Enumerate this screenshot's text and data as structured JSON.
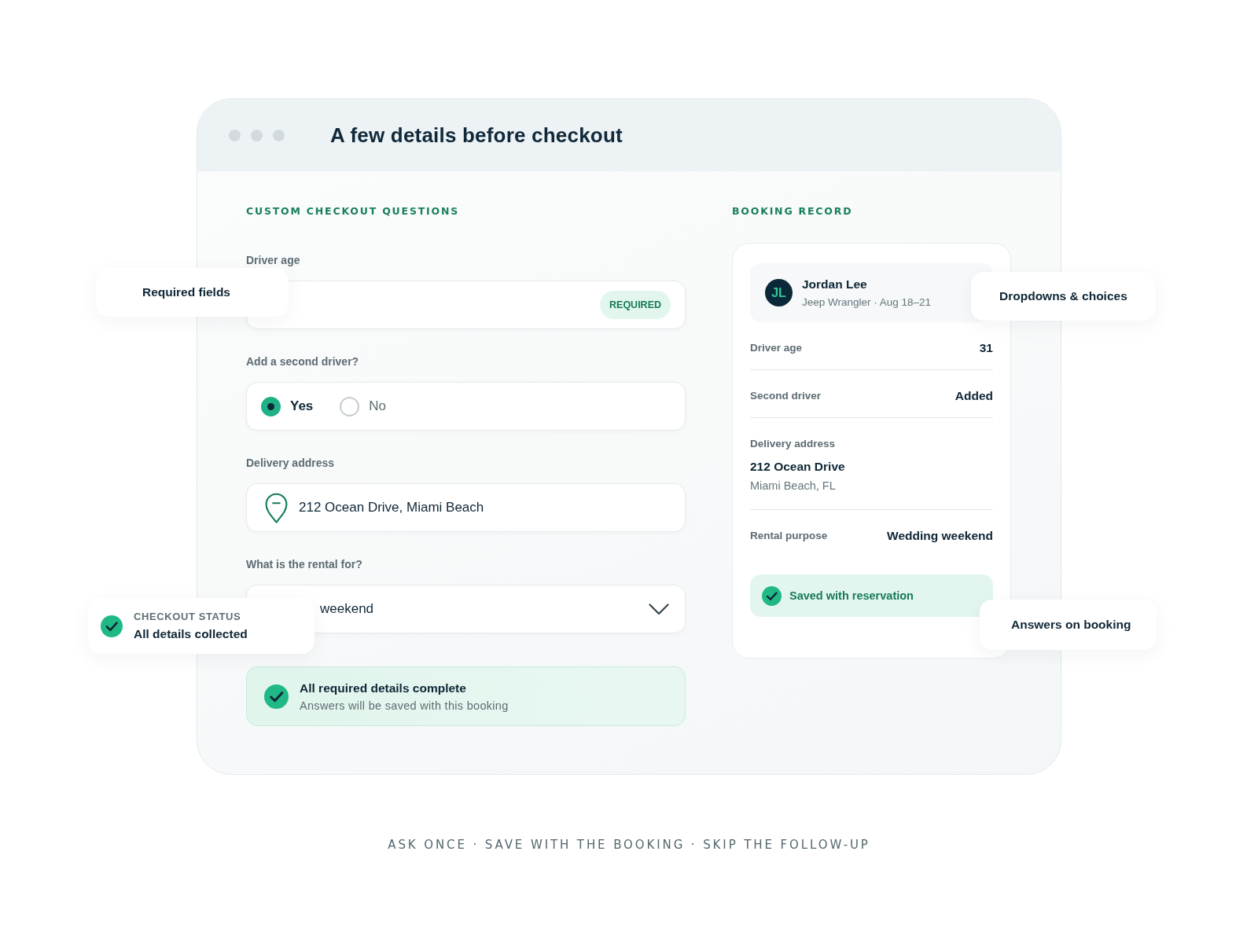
{
  "window": {
    "title": "A few details before checkout"
  },
  "questions": {
    "heading": "CUSTOM CHECKOUT QUESTIONS",
    "fields": [
      {
        "kind": "text",
        "label": "Driver age",
        "badge": "REQUIRED"
      },
      {
        "kind": "radio",
        "label": "Add a second driver?",
        "options": [
          {
            "label": "Yes",
            "selected": true
          },
          {
            "label": "No",
            "selected": false
          }
        ]
      },
      {
        "kind": "address",
        "label": "Delivery address",
        "value": "212 Ocean Drive, Miami Beach"
      },
      {
        "kind": "select",
        "label": "What is the rental for?",
        "value": "weekend"
      }
    ],
    "status_banner": {
      "title": "All required details complete",
      "subtitle": "Answers will be saved with this booking"
    }
  },
  "booking_record": {
    "heading": "BOOKING RECORD",
    "customer": {
      "initials": "JL",
      "name": "Jordan Lee",
      "details": "Jeep Wrangler · Aug 18–21"
    },
    "rows": [
      {
        "kind": "inline",
        "label": "Driver age",
        "value": "31"
      },
      {
        "kind": "inline",
        "label": "Second driver",
        "value": "Added"
      },
      {
        "kind": "stacked",
        "label": "Delivery address",
        "value": "212 Ocean Drive",
        "detail": "Miami Beach, FL"
      },
      {
        "kind": "inline",
        "label": "Rental purpose",
        "value": "Wedding weekend"
      }
    ],
    "saved_note": "Saved with reservation"
  },
  "callouts": [
    {
      "kind": "label",
      "text": "Required fields"
    },
    {
      "kind": "label",
      "text": "Dropdowns & choices"
    },
    {
      "kind": "status",
      "eyebrow": "CHECKOUT STATUS",
      "text": "All details collected"
    },
    {
      "kind": "label",
      "text": "Answers on booking"
    }
  ],
  "tagline": "ASK ONCE · SAVE WITH THE BOOKING · SKIP THE FOLLOW-UP"
}
